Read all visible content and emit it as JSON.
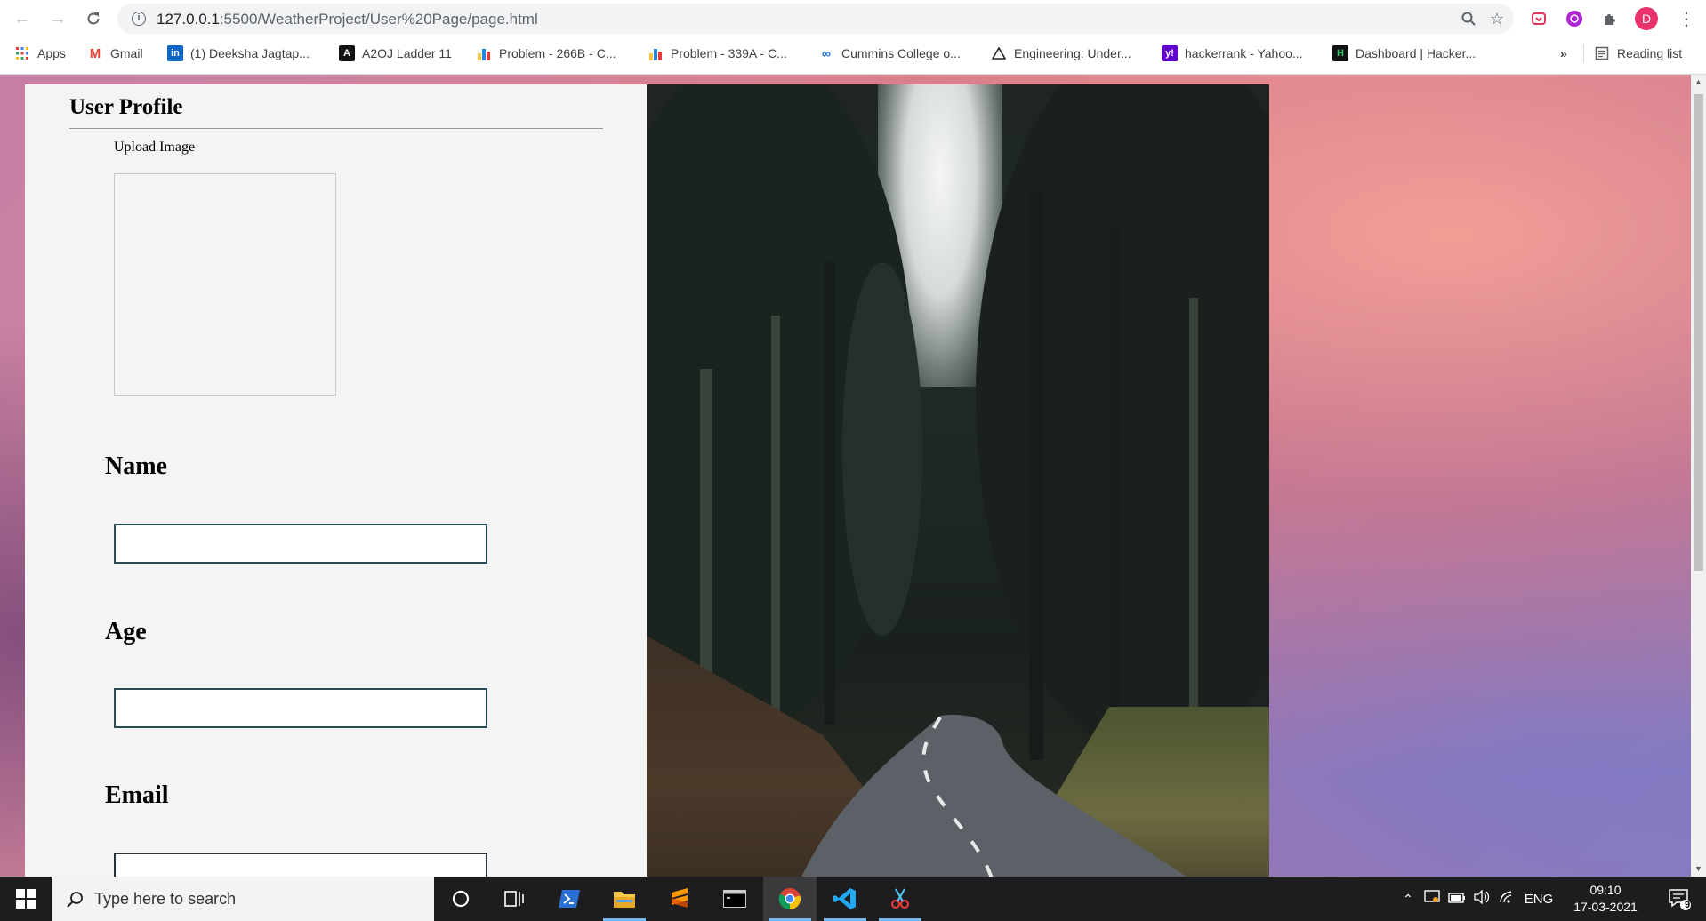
{
  "browser": {
    "url_host": "127.0.0.1",
    "url_rest": ":5500/WeatherProject/User%20Page/page.html",
    "avatar_letter": "D",
    "bookmarks": [
      {
        "label": "Apps",
        "icon": "apps-grid-icon"
      },
      {
        "label": "Gmail",
        "icon": "gmail-icon"
      },
      {
        "label": "(1) Deeksha Jagtap...",
        "icon": "linkedin-icon"
      },
      {
        "label": "A2OJ Ladder 11",
        "icon": "a2oj-icon"
      },
      {
        "label": "Problem - 266B - C...",
        "icon": "codeforces-icon"
      },
      {
        "label": "Problem - 339A - C...",
        "icon": "codeforces-icon"
      },
      {
        "label": "Cummins College o...",
        "icon": "cummins-icon"
      },
      {
        "label": "Engineering: Under...",
        "icon": "engineering-icon"
      },
      {
        "label": "hackerrank - Yahoo...",
        "icon": "yahoo-icon"
      },
      {
        "label": "Dashboard | Hacker...",
        "icon": "hackerrank-icon"
      }
    ],
    "overflow_label": "»",
    "reading_list_label": "Reading list"
  },
  "page": {
    "title": "User Profile",
    "upload_label": "Upload Image",
    "fields": {
      "name_label": "Name",
      "name_value": "",
      "age_label": "Age",
      "age_value": "",
      "email_label": "Email",
      "email_value": ""
    }
  },
  "taskbar": {
    "search_placeholder": "Type here to search",
    "language": "ENG",
    "time": "09:10",
    "date": "17-03-2021",
    "notification_count": "9"
  },
  "colors": {
    "card_bg": "#f4f4f4",
    "input_border": "#263238",
    "taskbar_bg": "#1d1d1f",
    "avatar_bg": "#e8336d"
  }
}
